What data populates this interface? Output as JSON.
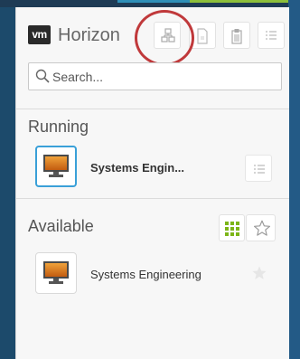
{
  "app": {
    "brand_logo": "vm",
    "brand_name": "Horizon"
  },
  "toolbar": {
    "buttons": [
      {
        "name": "switch-desktop-button",
        "icon": "shortcuts-icon"
      },
      {
        "name": "document-button",
        "icon": "document-icon"
      },
      {
        "name": "clipboard-button",
        "icon": "clipboard-icon"
      },
      {
        "name": "menu-button",
        "icon": "list-icon"
      }
    ]
  },
  "search": {
    "placeholder": "Search...",
    "value": ""
  },
  "sections": {
    "running": {
      "title": "Running",
      "items": [
        {
          "label": "Systems Engin...",
          "selected": true
        }
      ]
    },
    "available": {
      "title": "Available",
      "items": [
        {
          "label": "Systems Engineering",
          "favorite": false
        }
      ]
    }
  },
  "colors": {
    "accent_blue": "#3aa0d8",
    "grid_green": "#7cb518",
    "highlight_circle": "#c0393b",
    "desktop_background": "#1c4a6b"
  }
}
